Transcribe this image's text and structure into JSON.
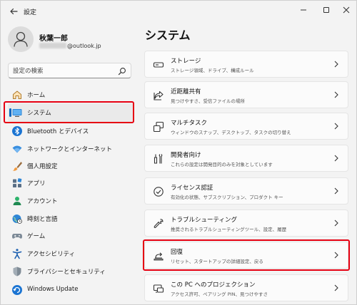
{
  "window": {
    "title": "設定"
  },
  "user": {
    "name": "秋葉一郎",
    "email_suffix": "@outlook.jp"
  },
  "search": {
    "placeholder": "設定の検索"
  },
  "sidebar": {
    "items": [
      {
        "label": "ホーム",
        "icon": "home-icon"
      },
      {
        "label": "システム",
        "icon": "system-display-icon",
        "active": true
      },
      {
        "label": "Bluetooth とデバイス",
        "icon": "bluetooth-icon"
      },
      {
        "label": "ネットワークとインターネット",
        "icon": "wifi-icon"
      },
      {
        "label": "個人用設定",
        "icon": "brush-icon"
      },
      {
        "label": "アプリ",
        "icon": "apps-icon"
      },
      {
        "label": "アカウント",
        "icon": "account-icon"
      },
      {
        "label": "時刻と言語",
        "icon": "globe-clock-icon"
      },
      {
        "label": "ゲーム",
        "icon": "gamepad-icon"
      },
      {
        "label": "アクセシビリティ",
        "icon": "accessibility-icon"
      },
      {
        "label": "プライバシーとセキュリティ",
        "icon": "shield-icon"
      },
      {
        "label": "Windows Update",
        "icon": "windows-update-icon"
      }
    ]
  },
  "main": {
    "title": "システム",
    "cards": [
      {
        "title": "ストレージ",
        "desc": "ストレージ領域、ドライブ、構成ルール",
        "icon": "storage-drive-icon"
      },
      {
        "title": "近距離共有",
        "desc": "見つけやすさ、受信ファイルの場所",
        "icon": "share-icon"
      },
      {
        "title": "マルチタスク",
        "desc": "ウィンドウのスナップ、デスクトップ、タスクの切り替え",
        "icon": "multitask-icon"
      },
      {
        "title": "開発者向け",
        "desc": "これらの設定は開発目的のみを対象としています",
        "icon": "developer-tools-icon"
      },
      {
        "title": "ライセンス認証",
        "desc": "有効化の状態、サブスクリプション、プロダクト キー",
        "icon": "activation-check-icon"
      },
      {
        "title": "トラブルシューティング",
        "desc": "推奨されるトラブルシューティングツール、設定、履歴",
        "icon": "wrench-icon"
      },
      {
        "title": "回復",
        "desc": "リセット、スタートアップの詳細設定、戻る",
        "icon": "recovery-icon"
      },
      {
        "title": "この PC へのプロジェクション",
        "desc": "アクセス許可、ペアリング PIN、見つけやすさ",
        "icon": "projection-icon"
      }
    ]
  },
  "colors": {
    "accent": "#0067c0",
    "highlight": "#e60012"
  }
}
